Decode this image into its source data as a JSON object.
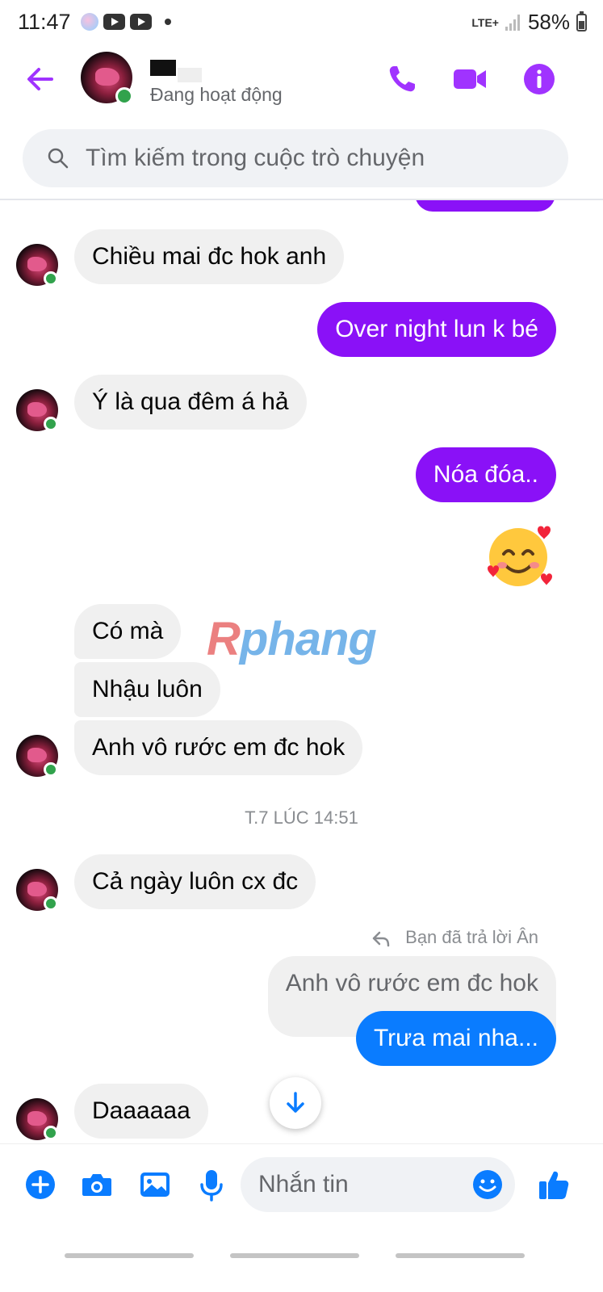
{
  "status_bar": {
    "time": "11:47",
    "network": "LTE+",
    "battery": "58%"
  },
  "header": {
    "active_status": "Đang hoạt động"
  },
  "search": {
    "placeholder": "Tìm kiếm trong cuộc trò chuyện"
  },
  "messages": [
    {
      "from": "them",
      "text": "Chiều mai đc hok anh"
    },
    {
      "from": "me",
      "text": "Over night lun k bé"
    },
    {
      "from": "them",
      "text": "Ý là qua đêm á hả"
    },
    {
      "from": "me",
      "text": "Nóa đóa.."
    },
    {
      "from": "them",
      "text": "Có mà"
    },
    {
      "from": "them",
      "text": "Nhậu luôn"
    },
    {
      "from": "them",
      "text": "Anh vô rước em đc hok"
    },
    {
      "from": "them",
      "text": "Cả ngày luôn cx đc"
    },
    {
      "from": "me",
      "text": "Trưa mai nha..."
    },
    {
      "from": "them",
      "text": "Daaaaaa"
    }
  ],
  "timestamp": "T.7 LÚC 14:51",
  "reply": {
    "label": "Bạn đã trả lời Ân",
    "quoted_text": "Anh vô rước em đc hok"
  },
  "watermark": "Rphang",
  "composer": {
    "placeholder": "Nhắn tin"
  },
  "colors": {
    "accent": "#a033ff",
    "sent_bubble_purple": "#8a11f7",
    "sent_bubble_blue": "#0a7cff",
    "received_bubble": "#f0f0f0",
    "online": "#31a24c",
    "composer_icons": "#0a7cff"
  },
  "icons": {
    "back": "arrow-left-icon",
    "call": "phone-icon",
    "video": "video-camera-icon",
    "info": "info-icon",
    "search": "search-icon",
    "add": "plus-circle-icon",
    "camera": "camera-icon",
    "gallery": "image-icon",
    "mic": "microphone-icon",
    "emoji": "smiley-icon",
    "like": "thumbs-up-icon",
    "scroll": "arrow-down-icon"
  }
}
